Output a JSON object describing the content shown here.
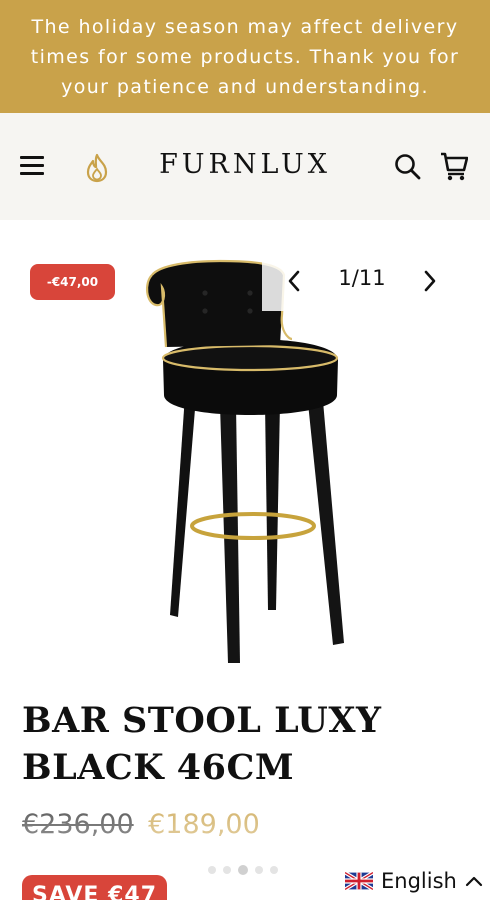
{
  "announcement": {
    "text": "The holiday season may affect delivery times for some products. Thank you for your patience and understanding."
  },
  "header": {
    "logo": "FURNLUX",
    "icons": [
      "menu-icon",
      "flame-icon",
      "search-icon",
      "cart-icon"
    ]
  },
  "gallery": {
    "discount_badge": "-€47,00",
    "counter": "1/11",
    "slide_index": 1,
    "slide_total": 11
  },
  "product": {
    "title": "BAR STOOL LUXY BLACK 46CM",
    "old_price": "€236,00",
    "new_price": "€189,00",
    "save_label": "SAVE €47"
  },
  "language": {
    "label": "English",
    "flag": "uk-flag-icon"
  },
  "colors": {
    "accent_gold": "#c9a24a",
    "badge_red": "#d8453a",
    "header_bg": "#f6f5f2"
  }
}
